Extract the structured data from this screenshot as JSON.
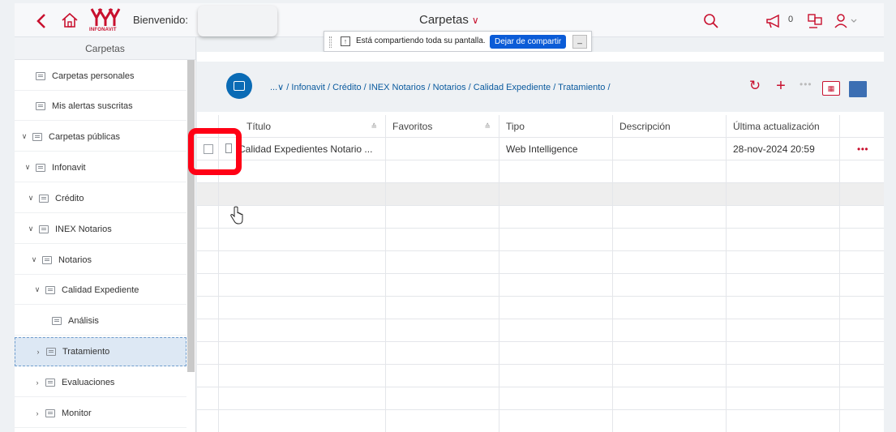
{
  "topbar": {
    "logo_text": "INFONAVIT",
    "welcome": "Bienvenido:",
    "title": "Carpetas",
    "notification_count": "0"
  },
  "share_bar": {
    "text": "Está compartiendo toda su pantalla.",
    "stop_button": "Dejar de compartir",
    "minimize_button": "_"
  },
  "sidebar": {
    "header": "Carpetas",
    "items": [
      {
        "label": "Carpetas personales",
        "chevron": ""
      },
      {
        "label": "Mis alertas suscritas",
        "chevron": ""
      },
      {
        "label": "Carpetas públicas",
        "chevron": "∨"
      },
      {
        "label": "Infonavit",
        "chevron": "∨"
      },
      {
        "label": "Crédito",
        "chevron": "∨"
      },
      {
        "label": "INEX Notarios",
        "chevron": "∨"
      },
      {
        "label": "Notarios",
        "chevron": "∨"
      },
      {
        "label": "Calidad Expediente",
        "chevron": "∨"
      },
      {
        "label": "Análisis",
        "chevron": ""
      },
      {
        "label": "Tratamiento",
        "chevron": "›"
      },
      {
        "label": "Evaluaciones",
        "chevron": "›"
      },
      {
        "label": "Monitor",
        "chevron": "›"
      }
    ]
  },
  "breadcrumb": {
    "prefix": "...∨",
    "path": "/ Infonavit / Crédito / INEX Notarios / Notarios / Calidad Expediente / Tratamiento /"
  },
  "actions": {
    "more": "•••",
    "grid": "▦"
  },
  "table": {
    "columns": [
      "Título",
      "Favoritos",
      "Tipo",
      "Descripción",
      "Última actualización"
    ],
    "rows": [
      {
        "title": "Calidad Expedientes Notario ...",
        "favorites": "",
        "type": "Web Intelligence",
        "description": "",
        "updated": "28-nov-2024 20:59",
        "more": "•••"
      }
    ]
  },
  "colors": {
    "accent": "#c8102e",
    "primary": "#0a6bb5",
    "highlight": "#ff0015"
  }
}
